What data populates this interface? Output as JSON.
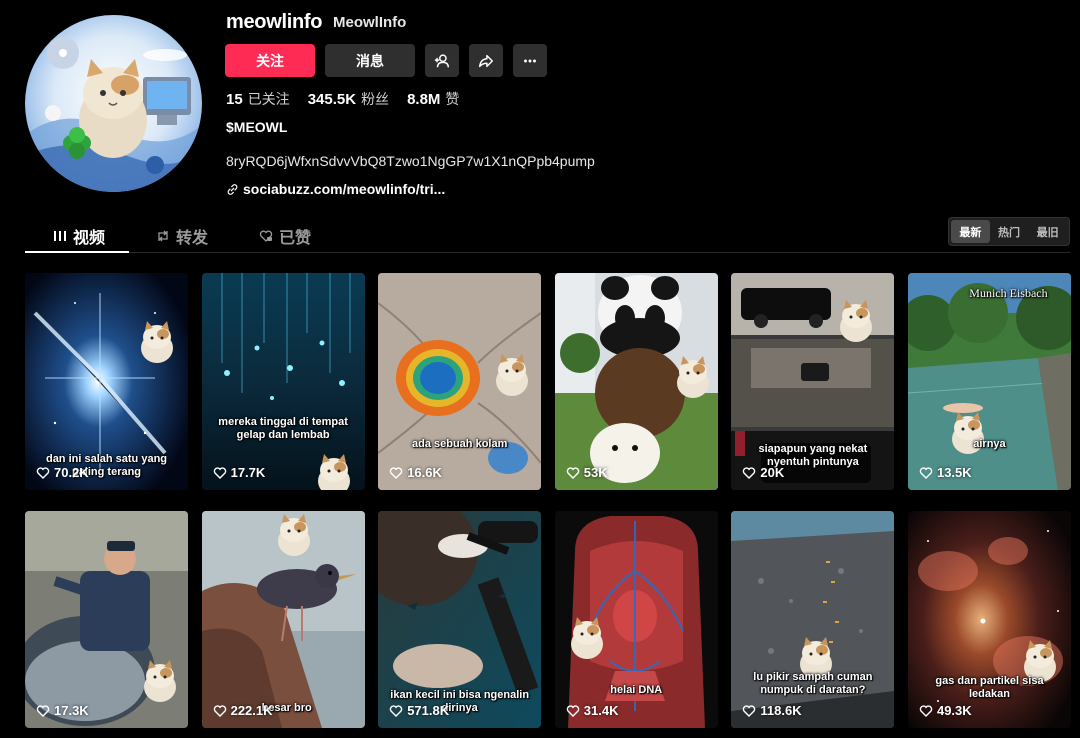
{
  "profile": {
    "username": "meowlinfo",
    "nickname": "MeowlInfo",
    "follow_label": "关注",
    "message_label": "消息",
    "stats": [
      {
        "value": "15",
        "label": "已关注"
      },
      {
        "value": "345.5K",
        "label": "粉丝"
      },
      {
        "value": "8.8M",
        "label": "赞"
      }
    ],
    "bio_line1": "$MEOWL",
    "bio_line2": "8ryRQD6jWfxnSdvvVbQ8Tzwo1NgGP7w1X1nQPpb4pump",
    "link": "sociabuzz.com/meowlinfo/tri..."
  },
  "tabs": [
    {
      "label": "视频",
      "icon": "grid-icon",
      "active": true
    },
    {
      "label": "转发",
      "icon": "repost-icon",
      "active": false
    },
    {
      "label": "已赞",
      "icon": "liked-heart-icon",
      "active": false
    }
  ],
  "sort": [
    {
      "label": "最新",
      "active": true
    },
    {
      "label": "热门",
      "active": false
    },
    {
      "label": "最旧",
      "active": false
    }
  ],
  "colors": {
    "accent": "#fe2c55",
    "background": "#000000",
    "button_dark": "#2f2f2f"
  },
  "videos": [
    {
      "caption": "dan ini salah satu yang paling terang",
      "views": "70.2K",
      "scene": "space-flare"
    },
    {
      "caption": "mereka tinggal di tempat gelap dan lembab",
      "views": "17.7K",
      "scene": "glowworm-cave"
    },
    {
      "caption": "ada sebuah kolam",
      "views": "16.6K",
      "scene": "hot-spring"
    },
    {
      "caption": "",
      "views": "53K",
      "scene": "panda-bear-stack"
    },
    {
      "caption": "siapapun yang nekat nyentuh pintunya",
      "views": "20K",
      "scene": "motorcade"
    },
    {
      "caption": "airnya",
      "views": "13.5K",
      "scene": "river-swim",
      "overlay_text": "Munich Eisbach"
    },
    {
      "caption": "",
      "views": "17.3K",
      "scene": "fisherman-tuna"
    },
    {
      "caption": "besar bro",
      "views": "222.1K",
      "scene": "bird-rock"
    },
    {
      "caption": "ikan kecil ini bisa ngenalin dirinya",
      "views": "571.8K",
      "scene": "diver-fish"
    },
    {
      "caption": "helai DNA",
      "views": "31.4K",
      "scene": "anatomy"
    },
    {
      "caption": "lu pikir sampah cuman numpuk di daratan?",
      "views": "118.6K",
      "scene": "ocean-trash"
    },
    {
      "caption": "gas dan partikel sisa ledakan",
      "views": "49.3K",
      "scene": "nebula"
    }
  ]
}
